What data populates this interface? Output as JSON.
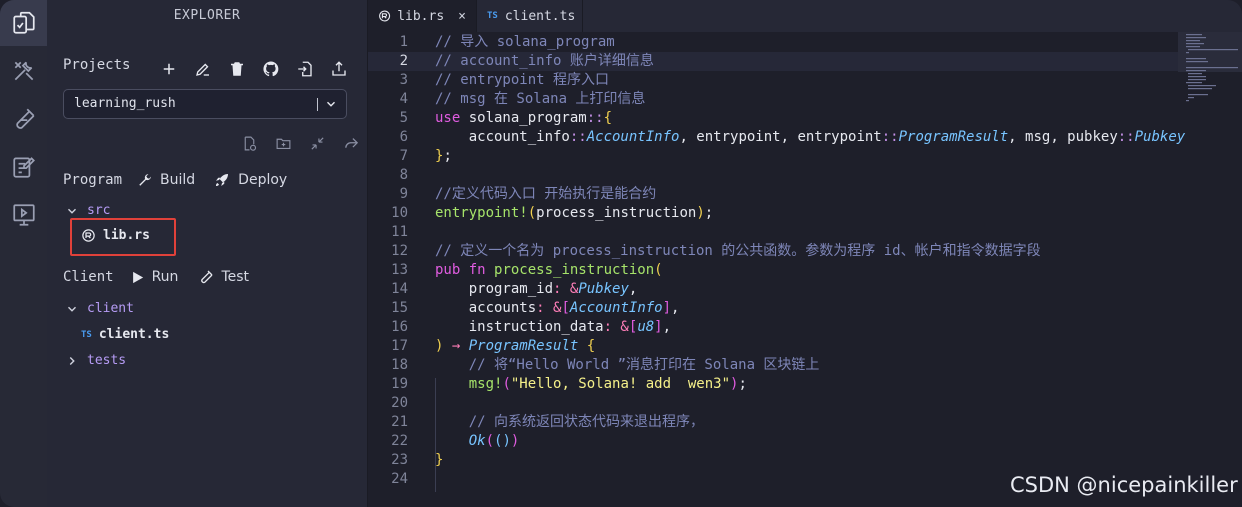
{
  "sidebar": {
    "title": "EXPLORER",
    "projects_label": "Projects",
    "project_select_value": "learning_rush",
    "program_label": "Program",
    "build_label": "Build",
    "deploy_label": "Deploy",
    "client_label": "Client",
    "run_label": "Run",
    "test_label": "Test",
    "tree": {
      "src_folder": "src",
      "lib_file": "lib.rs",
      "client_folder": "client",
      "client_file": "client.ts",
      "client_file_badge": "TS",
      "tests_folder": "tests"
    }
  },
  "tabs": [
    {
      "label": "lib.rs",
      "close": "×"
    },
    {
      "label": "client.ts",
      "badge": "TS"
    }
  ],
  "editor": {
    "current_line": 2,
    "lines": [
      [
        {
          "t": "// 导入 solana_program",
          "c": "#7e86b8"
        }
      ],
      [
        {
          "t": "// account_info 账户详细信息",
          "c": "#7e86b8"
        }
      ],
      [
        {
          "t": "// entrypoint 程序入口",
          "c": "#7e86b8"
        }
      ],
      [
        {
          "t": "// msg 在 Solana 上打印信息",
          "c": "#7e86b8"
        }
      ],
      [
        {
          "t": "use ",
          "c": "#e05ce0"
        },
        {
          "t": "solana_program",
          "c": "#e6e8ef"
        },
        {
          "t": "::",
          "c": "#c792ea"
        },
        {
          "t": "{",
          "c": "#f0d050"
        }
      ],
      [
        {
          "t": "    account_info",
          "c": "#e6e8ef"
        },
        {
          "t": "::",
          "c": "#c792ea"
        },
        {
          "t": "AccountInfo",
          "c": "#78c4ff",
          "i": true
        },
        {
          "t": ", entrypoint, entrypoint",
          "c": "#e6e8ef"
        },
        {
          "t": "::",
          "c": "#c792ea"
        },
        {
          "t": "ProgramResult",
          "c": "#78c4ff",
          "i": true
        },
        {
          "t": ", msg, pubkey",
          "c": "#e6e8ef"
        },
        {
          "t": "::",
          "c": "#c792ea"
        },
        {
          "t": "Pubkey",
          "c": "#78c4ff",
          "i": true
        }
      ],
      [
        {
          "t": "}",
          "c": "#f0d050"
        },
        {
          "t": ";",
          "c": "#e6e8ef"
        }
      ],
      [],
      [
        {
          "t": "//定义代码入口 开始执行是能合约",
          "c": "#7e86b8"
        }
      ],
      [
        {
          "t": "entrypoint!",
          "c": "#a6e36a"
        },
        {
          "t": "(",
          "c": "#f0d050"
        },
        {
          "t": "process_instruction",
          "c": "#e6e8ef"
        },
        {
          "t": ")",
          "c": "#f0d050"
        },
        {
          "t": ";",
          "c": "#e6e8ef"
        }
      ],
      [],
      [
        {
          "t": "// 定义一个名为 process_instruction 的公共函数。参数为程序 id、帐户和指令数据字段",
          "c": "#7e86b8"
        }
      ],
      [
        {
          "t": "pub fn ",
          "c": "#e05ce0"
        },
        {
          "t": "process_instruction",
          "c": "#a6e36a"
        },
        {
          "t": "(",
          "c": "#f0d050"
        }
      ],
      [
        {
          "t": "    program_id",
          "c": "#e6e8ef"
        },
        {
          "t": ": &",
          "c": "#ff7eb8"
        },
        {
          "t": "Pubkey",
          "c": "#78c4ff",
          "i": true
        },
        {
          "t": ",",
          "c": "#e6e8ef"
        }
      ],
      [
        {
          "t": "    accounts",
          "c": "#e6e8ef"
        },
        {
          "t": ": &",
          "c": "#ff7eb8"
        },
        {
          "t": "[",
          "c": "#e05ce0"
        },
        {
          "t": "AccountInfo",
          "c": "#78c4ff",
          "i": true
        },
        {
          "t": "]",
          "c": "#e05ce0"
        },
        {
          "t": ",",
          "c": "#e6e8ef"
        }
      ],
      [
        {
          "t": "    instruction_data",
          "c": "#e6e8ef"
        },
        {
          "t": ": &",
          "c": "#ff7eb8"
        },
        {
          "t": "[",
          "c": "#e05ce0"
        },
        {
          "t": "u8",
          "c": "#78c4ff",
          "i": true
        },
        {
          "t": "]",
          "c": "#e05ce0"
        },
        {
          "t": ",",
          "c": "#e6e8ef"
        }
      ],
      [
        {
          "t": ")",
          "c": "#f0d050"
        },
        {
          "t": " → ",
          "c": "#ff7eb8"
        },
        {
          "t": "ProgramResult",
          "c": "#78c4ff",
          "i": true
        },
        {
          "t": " {",
          "c": "#f0d050"
        }
      ],
      [
        {
          "t": "    // 将“Hello World ”消息打印在 Solana 区块链上",
          "c": "#7e86b8"
        }
      ],
      [
        {
          "t": "    msg!",
          "c": "#a6e36a"
        },
        {
          "t": "(",
          "c": "#e05ce0"
        },
        {
          "t": "\"Hello, Solana! add  wen3\"",
          "c": "#f5f08a"
        },
        {
          "t": ")",
          "c": "#e05ce0"
        },
        {
          "t": ";",
          "c": "#e6e8ef"
        }
      ],
      [],
      [
        {
          "t": "    // 向系统返回状态代码来退出程序，",
          "c": "#7e86b8"
        }
      ],
      [
        {
          "t": "    Ok",
          "c": "#78c4ff",
          "i": true
        },
        {
          "t": "(",
          "c": "#e05ce0"
        },
        {
          "t": "()",
          "c": "#78c4ff"
        },
        {
          "t": ")",
          "c": "#e05ce0"
        }
      ],
      [
        {
          "t": "}",
          "c": "#f0d050"
        }
      ],
      []
    ]
  },
  "watermark": "CSDN @nicepainkiller",
  "colors": {
    "background": "#1e1f2a",
    "sidebar": "#262836",
    "highlight_box": "#e0413a",
    "folder": "#b69cf5"
  }
}
